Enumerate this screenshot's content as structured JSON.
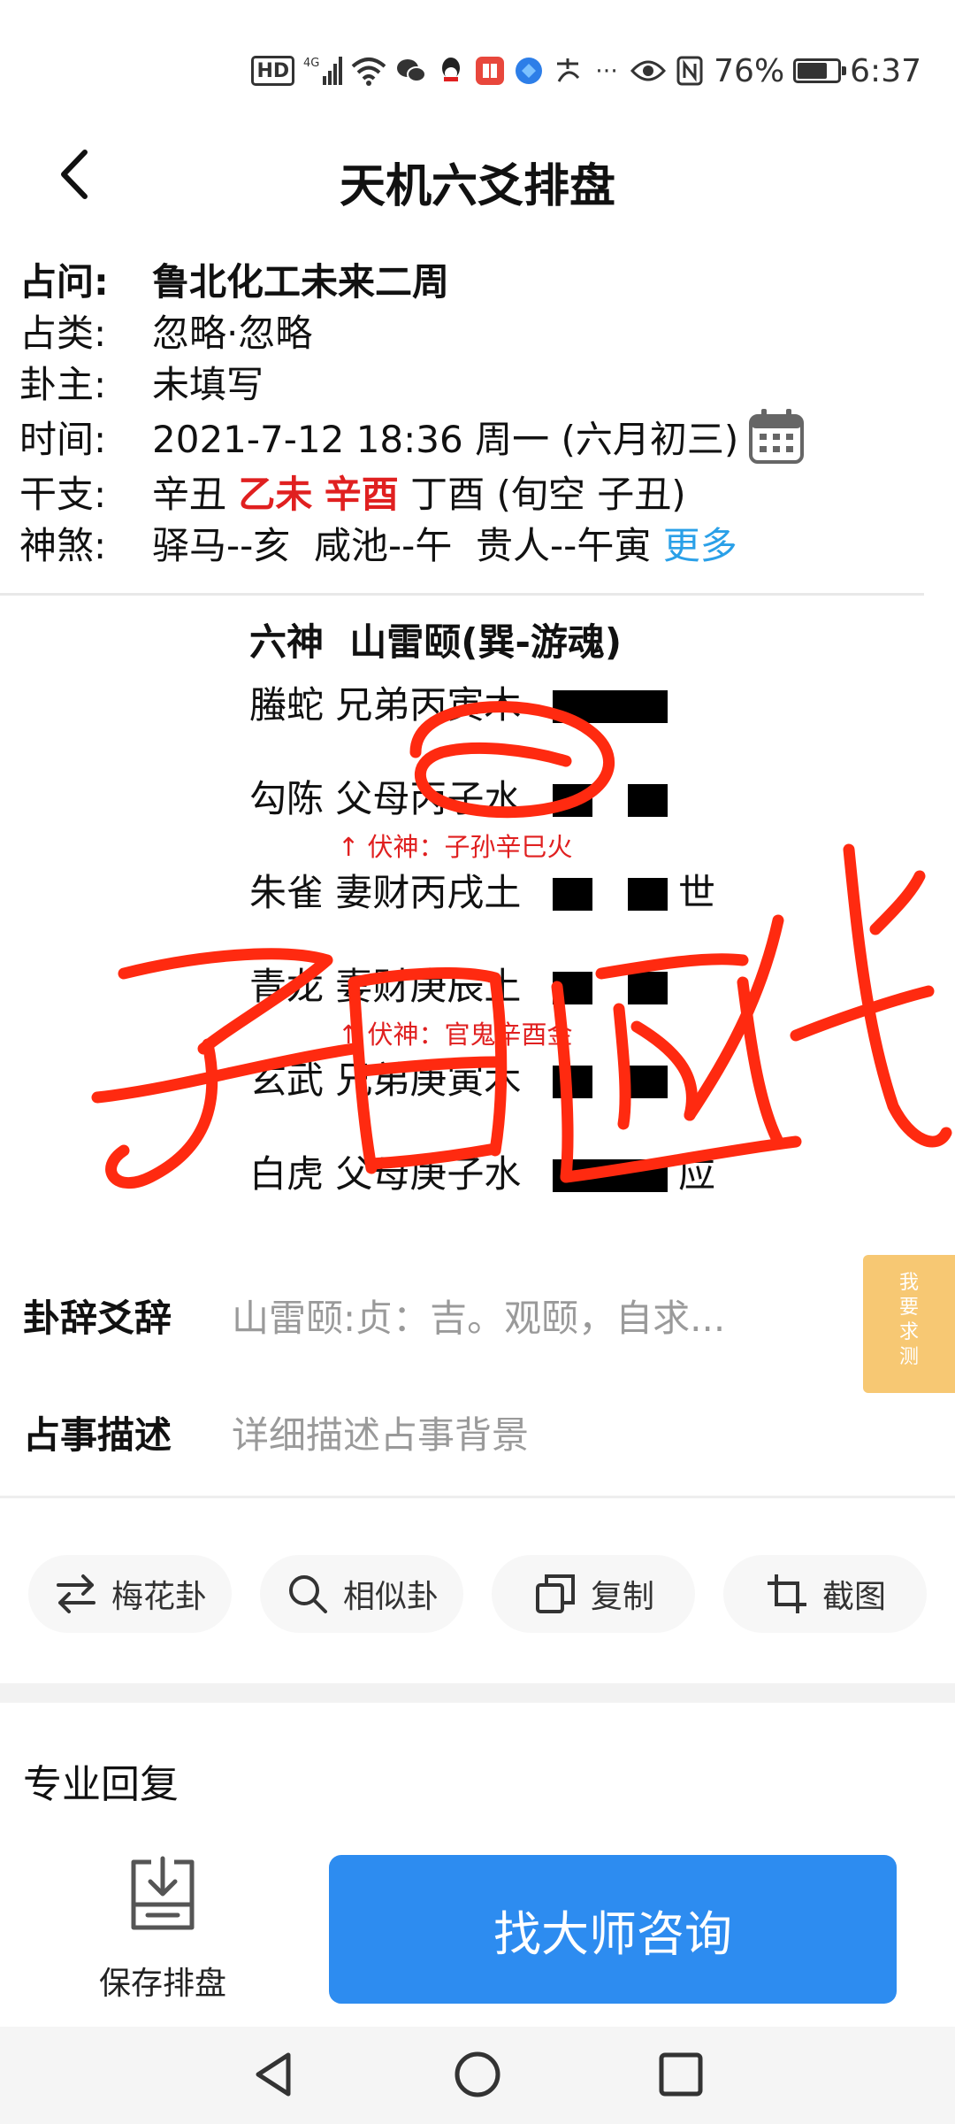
{
  "status": {
    "battery": "76%",
    "time": "6:37",
    "network": "4G"
  },
  "header": {
    "title": "天机六爻排盘"
  },
  "info": {
    "question_label": "占问:",
    "question": "鲁北化工未来二周",
    "category_label": "占类:",
    "category": "忽略·忽略",
    "owner_label": "卦主:",
    "owner": "未填写",
    "time_label": "时间:",
    "time": "2021-7-12 18:36 周一 (六月初三)",
    "ganzhi_label": "干支:",
    "gz_year": "辛丑",
    "gz_month": "乙未",
    "gz_day": "辛酉",
    "gz_hour": "丁酉",
    "xunkong": "(旬空 子丑)",
    "shensha_label": "神煞:",
    "shensha": "驿马--亥  咸池--午  贵人--午寅",
    "more": "更多"
  },
  "hexagram": {
    "header": "六神  山雷颐(巽-游魂)",
    "lines": [
      {
        "text": "螣蛇 兄弟丙寅木",
        "yao": "yang",
        "mark": "",
        "fushen": ""
      },
      {
        "text": "勾陈 父母丙子水",
        "yao": "yin",
        "mark": "",
        "fushen": "↑ 伏神：子孙辛巳火"
      },
      {
        "text": "朱雀 妻财丙戌土",
        "yao": "yin",
        "mark": "世",
        "fushen": ""
      },
      {
        "text": "青龙 妻财庚辰土",
        "yao": "yin",
        "mark": "",
        "fushen": "↑ 伏神：官鬼辛酉金"
      },
      {
        "text": "玄武 兄弟庚寅木",
        "yao": "yin",
        "mark": "",
        "fushen": ""
      },
      {
        "text": "白虎 父母庚子水",
        "yao": "yang",
        "mark": "应",
        "fushen": ""
      }
    ]
  },
  "annotation": {
    "text": "子日临伏",
    "color": "#ff2a10"
  },
  "guaci": {
    "label": "卦辞爻辞",
    "value": "山雷颐:贞：吉。观颐，自求..."
  },
  "describe": {
    "label": "占事描述",
    "placeholder": "详细描述占事背景"
  },
  "float_tab": {
    "chars": [
      "我",
      "要",
      "求",
      "测"
    ]
  },
  "actions": [
    {
      "label": "梅花卦",
      "icon": "swap-icon"
    },
    {
      "label": "相似卦",
      "icon": "search-icon"
    },
    {
      "label": "复制",
      "icon": "copy-icon"
    },
    {
      "label": "截图",
      "icon": "crop-icon"
    }
  ],
  "reply": {
    "title": "专业回复"
  },
  "bottom": {
    "save_label": "保存排盘",
    "consult_label": "找大师咨询"
  }
}
